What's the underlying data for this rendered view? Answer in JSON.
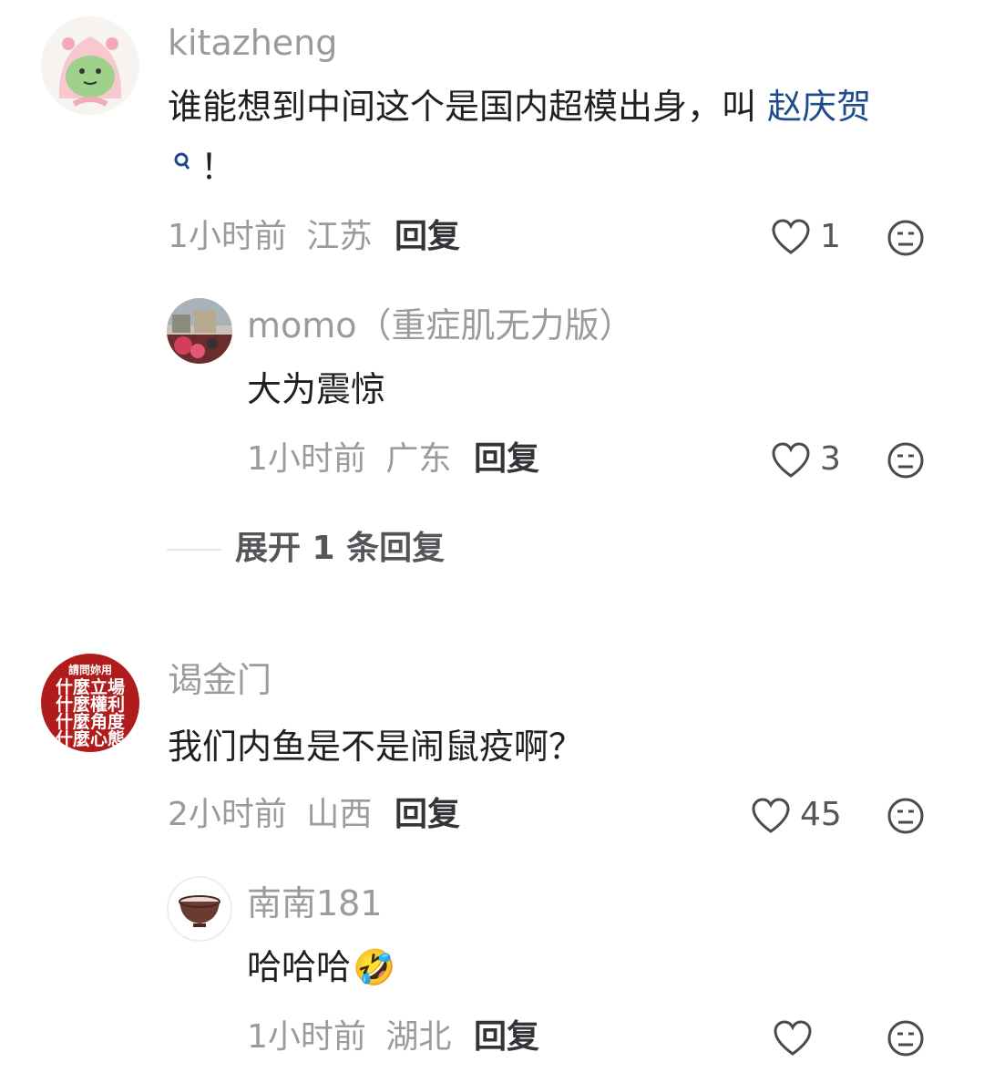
{
  "comments": [
    {
      "username": "kitazheng",
      "text_line1": "谁能想到中间这个是国内超模出身，叫 ",
      "link_text": "赵庆贺",
      "text_line2_suffix": "！",
      "time": "1小时前",
      "location": "江苏",
      "reply_label": "回复",
      "likes": "1",
      "replies": [
        {
          "username": "momo（重症肌无力版）",
          "text": "大为震惊",
          "time": "1小时前",
          "location": "广东",
          "reply_label": "回复",
          "likes": "3"
        }
      ],
      "expand_label": "展开 1 条回复"
    },
    {
      "username": "谒金门",
      "avatar_text": [
        "請問妳用",
        "什麼立場",
        "什麼權利",
        "什麼角度",
        "什麼心態"
      ],
      "text": "我们内鱼是不是闹鼠疫啊？",
      "time": "2小时前",
      "location": "山西",
      "reply_label": "回复",
      "likes": "45",
      "replies": [
        {
          "username": "南南181",
          "text": "哈哈哈",
          "emoji": "🤣",
          "time": "1小时前",
          "location": "湖北",
          "reply_label": "回复",
          "likes": ""
        }
      ]
    }
  ],
  "icons": {
    "like": "heart-outline-icon",
    "dislike": "meh-face-icon",
    "search": "search-icon"
  },
  "colors": {
    "link": "#1f4a8c",
    "meta": "#9a9a9f",
    "avatar_red": "#b01c1c"
  }
}
